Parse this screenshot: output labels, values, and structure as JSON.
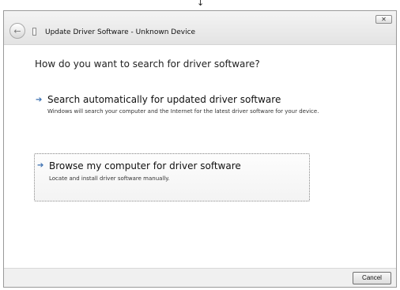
{
  "window": {
    "title": "Update Driver Software - Unknown Device",
    "close_glyph": "✕",
    "back_glyph": "←"
  },
  "top_marker": {
    "glyph": "↓"
  },
  "question": "How do you want to search for driver software?",
  "options": [
    {
      "arrow": "➔",
      "title": "Search automatically for updated driver software",
      "description": "Windows will search your computer and the Internet for the latest driver software for your device."
    },
    {
      "arrow": "➔",
      "title": "Browse my computer for driver software",
      "description": "Locate and install driver software manually."
    }
  ],
  "buttons": {
    "cancel": "Cancel"
  }
}
